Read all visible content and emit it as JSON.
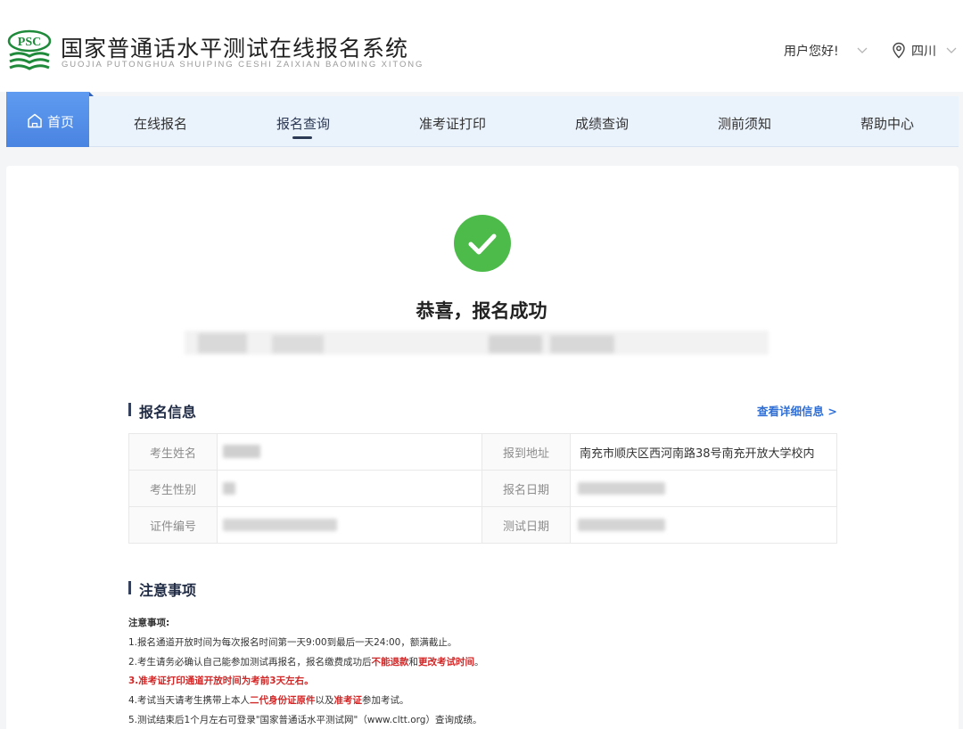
{
  "header": {
    "logo_text": "PSC",
    "title": "国家普通话水平测试在线报名系统",
    "subtitle": "GUOJIA PUTONGHUA SHUIPING CESHI ZAIXIAN BAOMING XITONG",
    "greeting": "用户您好!",
    "region": "四川"
  },
  "nav": {
    "home": "首页",
    "items": [
      "在线报名",
      "报名查询",
      "准考证打印",
      "成绩查询",
      "测前须知",
      "帮助中心"
    ],
    "active": "报名查询"
  },
  "result": {
    "title": "恭喜，报名成功"
  },
  "info": {
    "section_title": "报名信息",
    "detail_link": "查看详细信息 >",
    "labels": {
      "name": "考生姓名",
      "gender": "考生性别",
      "id_no": "证件编号",
      "address": "报到地址",
      "reg_date": "报名日期",
      "test_date": "测试日期"
    },
    "address_value": "南充市顺庆区西河南路38号南充开放大学校内"
  },
  "notes": {
    "section_title": "注意事项",
    "heading": "注意事项:",
    "line1": "1.报名通道开放时间为每次报名时间第一天9:00到最后一天24:00，额满截止。",
    "line2_a": "2.考生请务必确认自己能参加测试再报名，报名缴费成功后",
    "line2_b": "不能退款",
    "line2_c": "和",
    "line2_d": "更改考试时间",
    "line2_e": "。",
    "line3": "3.准考证打印通道开放时间为考前3天左右。",
    "line4_a": "4.考试当天请考生携带上本人",
    "line4_b": "二代身份证原件",
    "line4_c": "以及",
    "line4_d": "准考证",
    "line4_e": "参加考试。",
    "line5": "5.测试结束后1个月左右可登录\"国家普通话水平测试网\"（www.cltt.org）查询成绩。"
  },
  "colors": {
    "nav_active_bg": "#4a84e2",
    "nav_bg": "#eaf2fc",
    "success": "#4cbb4a",
    "link": "#2f6fd6",
    "warning": "#d22727",
    "logo_green": "#1e8a3a"
  }
}
